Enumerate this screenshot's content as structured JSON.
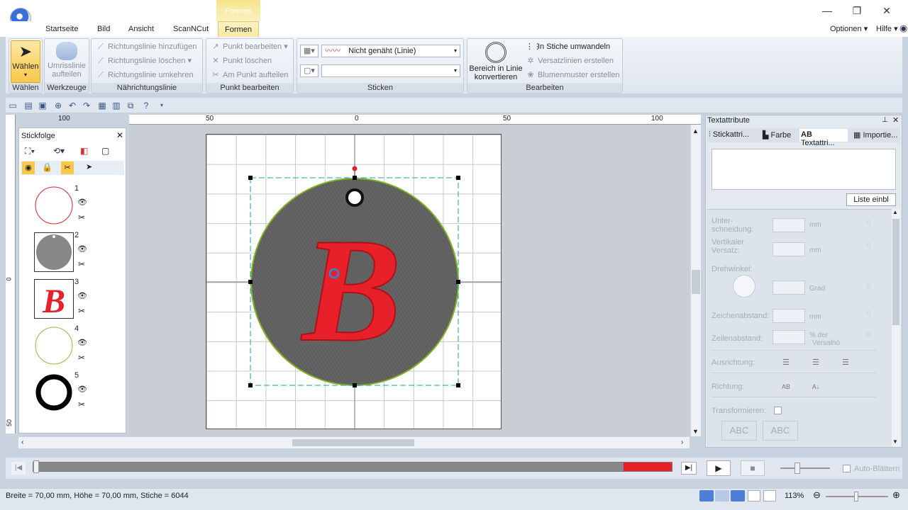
{
  "app": {
    "context_tab_label": "Formen",
    "window_controls": {
      "minimize": "—",
      "restore": "❐",
      "close": "✕"
    }
  },
  "ribbon_tabs": [
    "Startseite",
    "Bild",
    "Ansicht",
    "ScanNCut",
    "Formen"
  ],
  "ribbon_right": {
    "options": "Optionen",
    "help": "Hilfe"
  },
  "groups": {
    "waehlen": {
      "label": "Wählen",
      "button": "Wählen"
    },
    "werkzeuge": {
      "label": "Werkzeuge",
      "button_line1": "Umrisslinie",
      "button_line2": "aufteilen"
    },
    "naehrichtungslinie": {
      "label": "Nährichtungslinie",
      "items": [
        "Richtungslinie hinzufügen",
        "Richtungslinie löschen",
        "Richtungslinie umkehren"
      ]
    },
    "punkt": {
      "label": "Punkt bearbeiten",
      "items": [
        "Punkt bearbeiten",
        "Punkt löschen",
        "Am Punkt aufteilen"
      ]
    },
    "sticken": {
      "label": "Sticken",
      "line_type": "Nicht genäht (Linie)"
    },
    "bearbeiten": {
      "label": "Bearbeiten",
      "big_line1": "Bereich in Linie",
      "big_line2": "konvertieren",
      "items": [
        "In Stiche umwandeln",
        "Versatzlinien erstellen",
        "Blumenmuster erstellen"
      ]
    }
  },
  "stickfolge": {
    "title": "Stickfolge",
    "items": [
      {
        "num": "1"
      },
      {
        "num": "2"
      },
      {
        "num": "3"
      },
      {
        "num": "4"
      },
      {
        "num": "5"
      }
    ]
  },
  "rulers": {
    "h_labels": [
      "100",
      "50",
      "0",
      "50",
      "100"
    ],
    "v_labels": [
      "0",
      "50"
    ]
  },
  "textattribute": {
    "title": "Textattribute",
    "tabs": [
      "Stickattri...",
      "Farbe",
      "Textattri...",
      "Importie..."
    ],
    "list_button": "Liste einbl",
    "labels": {
      "unterschneidung_1": "Unter-",
      "unterschneidung_2": "schneidung:",
      "vertikal_1": "Vertikaler",
      "vertikal_2": "Versatz:",
      "drehwinkel": "Drehwinkel:",
      "zeichenabstand": "Zeichenabstand:",
      "zeilenabstand": "Zeilenabstand:",
      "ausrichtung": "Ausrichtung:",
      "richtung": "Richtung:",
      "transformieren": "Transformieren:"
    },
    "units": {
      "mm": "mm",
      "grad": "Grad",
      "percent_1": "% der",
      "percent_2": "Versalhö"
    },
    "abc": "ABC"
  },
  "playback": {
    "auto_blaettern": "Auto-Blättern"
  },
  "status": {
    "text": "Breite = 70,00 mm, Höhe = 70,00 mm, Stiche = 6044",
    "zoom": "113%"
  },
  "colors": {
    "accent_tab": "#f9e8a3",
    "stitch_red": "#e8202a",
    "circle_gray": "#5f5f5f",
    "progress_red": "#e8202a"
  }
}
